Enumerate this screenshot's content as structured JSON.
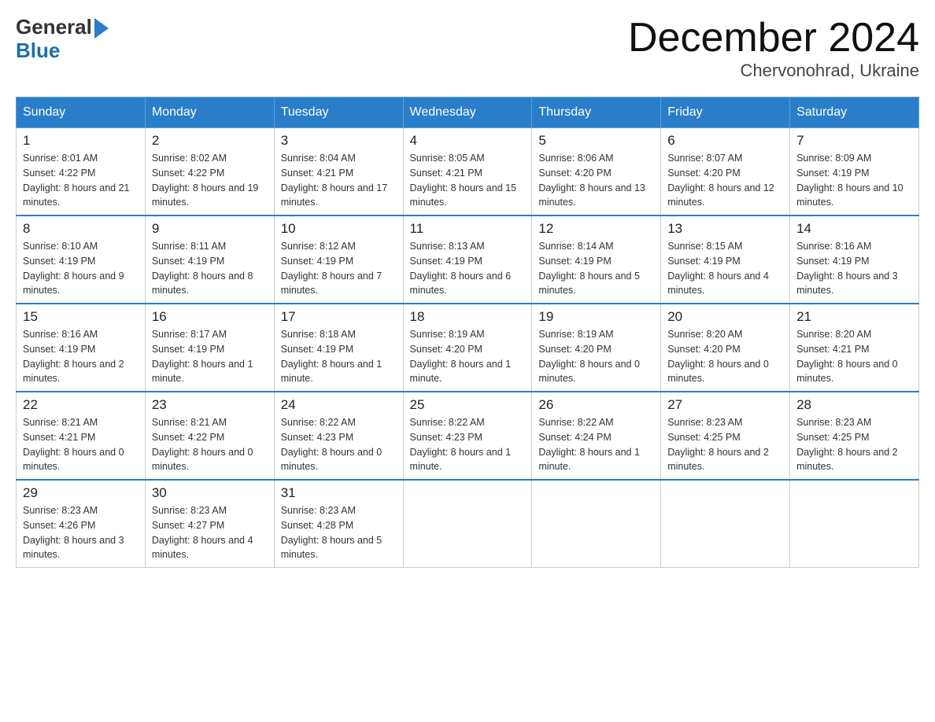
{
  "header": {
    "title": "December 2024",
    "location": "Chervonohrad, Ukraine",
    "logo_general": "General",
    "logo_blue": "Blue"
  },
  "columns": [
    "Sunday",
    "Monday",
    "Tuesday",
    "Wednesday",
    "Thursday",
    "Friday",
    "Saturday"
  ],
  "weeks": [
    [
      {
        "day": "1",
        "sunrise": "8:01 AM",
        "sunset": "4:22 PM",
        "daylight": "8 hours and 21 minutes."
      },
      {
        "day": "2",
        "sunrise": "8:02 AM",
        "sunset": "4:22 PM",
        "daylight": "8 hours and 19 minutes."
      },
      {
        "day": "3",
        "sunrise": "8:04 AM",
        "sunset": "4:21 PM",
        "daylight": "8 hours and 17 minutes."
      },
      {
        "day": "4",
        "sunrise": "8:05 AM",
        "sunset": "4:21 PM",
        "daylight": "8 hours and 15 minutes."
      },
      {
        "day": "5",
        "sunrise": "8:06 AM",
        "sunset": "4:20 PM",
        "daylight": "8 hours and 13 minutes."
      },
      {
        "day": "6",
        "sunrise": "8:07 AM",
        "sunset": "4:20 PM",
        "daylight": "8 hours and 12 minutes."
      },
      {
        "day": "7",
        "sunrise": "8:09 AM",
        "sunset": "4:19 PM",
        "daylight": "8 hours and 10 minutes."
      }
    ],
    [
      {
        "day": "8",
        "sunrise": "8:10 AM",
        "sunset": "4:19 PM",
        "daylight": "8 hours and 9 minutes."
      },
      {
        "day": "9",
        "sunrise": "8:11 AM",
        "sunset": "4:19 PM",
        "daylight": "8 hours and 8 minutes."
      },
      {
        "day": "10",
        "sunrise": "8:12 AM",
        "sunset": "4:19 PM",
        "daylight": "8 hours and 7 minutes."
      },
      {
        "day": "11",
        "sunrise": "8:13 AM",
        "sunset": "4:19 PM",
        "daylight": "8 hours and 6 minutes."
      },
      {
        "day": "12",
        "sunrise": "8:14 AM",
        "sunset": "4:19 PM",
        "daylight": "8 hours and 5 minutes."
      },
      {
        "day": "13",
        "sunrise": "8:15 AM",
        "sunset": "4:19 PM",
        "daylight": "8 hours and 4 minutes."
      },
      {
        "day": "14",
        "sunrise": "8:16 AM",
        "sunset": "4:19 PM",
        "daylight": "8 hours and 3 minutes."
      }
    ],
    [
      {
        "day": "15",
        "sunrise": "8:16 AM",
        "sunset": "4:19 PM",
        "daylight": "8 hours and 2 minutes."
      },
      {
        "day": "16",
        "sunrise": "8:17 AM",
        "sunset": "4:19 PM",
        "daylight": "8 hours and 1 minute."
      },
      {
        "day": "17",
        "sunrise": "8:18 AM",
        "sunset": "4:19 PM",
        "daylight": "8 hours and 1 minute."
      },
      {
        "day": "18",
        "sunrise": "8:19 AM",
        "sunset": "4:20 PM",
        "daylight": "8 hours and 1 minute."
      },
      {
        "day": "19",
        "sunrise": "8:19 AM",
        "sunset": "4:20 PM",
        "daylight": "8 hours and 0 minutes."
      },
      {
        "day": "20",
        "sunrise": "8:20 AM",
        "sunset": "4:20 PM",
        "daylight": "8 hours and 0 minutes."
      },
      {
        "day": "21",
        "sunrise": "8:20 AM",
        "sunset": "4:21 PM",
        "daylight": "8 hours and 0 minutes."
      }
    ],
    [
      {
        "day": "22",
        "sunrise": "8:21 AM",
        "sunset": "4:21 PM",
        "daylight": "8 hours and 0 minutes."
      },
      {
        "day": "23",
        "sunrise": "8:21 AM",
        "sunset": "4:22 PM",
        "daylight": "8 hours and 0 minutes."
      },
      {
        "day": "24",
        "sunrise": "8:22 AM",
        "sunset": "4:23 PM",
        "daylight": "8 hours and 0 minutes."
      },
      {
        "day": "25",
        "sunrise": "8:22 AM",
        "sunset": "4:23 PM",
        "daylight": "8 hours and 1 minute."
      },
      {
        "day": "26",
        "sunrise": "8:22 AM",
        "sunset": "4:24 PM",
        "daylight": "8 hours and 1 minute."
      },
      {
        "day": "27",
        "sunrise": "8:23 AM",
        "sunset": "4:25 PM",
        "daylight": "8 hours and 2 minutes."
      },
      {
        "day": "28",
        "sunrise": "8:23 AM",
        "sunset": "4:25 PM",
        "daylight": "8 hours and 2 minutes."
      }
    ],
    [
      {
        "day": "29",
        "sunrise": "8:23 AM",
        "sunset": "4:26 PM",
        "daylight": "8 hours and 3 minutes."
      },
      {
        "day": "30",
        "sunrise": "8:23 AM",
        "sunset": "4:27 PM",
        "daylight": "8 hours and 4 minutes."
      },
      {
        "day": "31",
        "sunrise": "8:23 AM",
        "sunset": "4:28 PM",
        "daylight": "8 hours and 5 minutes."
      },
      null,
      null,
      null,
      null
    ]
  ],
  "labels": {
    "sunrise": "Sunrise:",
    "sunset": "Sunset:",
    "daylight": "Daylight:"
  }
}
